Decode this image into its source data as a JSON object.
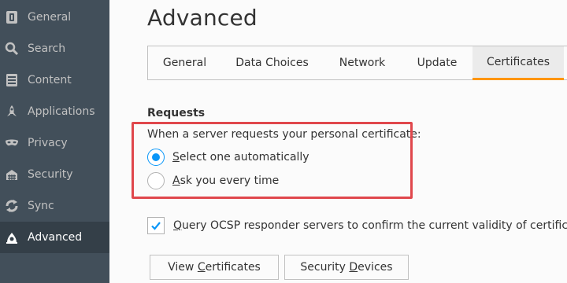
{
  "sidebar": {
    "items": [
      {
        "label": "General",
        "icon": "general-icon"
      },
      {
        "label": "Search",
        "icon": "search-icon"
      },
      {
        "label": "Content",
        "icon": "content-icon"
      },
      {
        "label": "Applications",
        "icon": "applications-icon"
      },
      {
        "label": "Privacy",
        "icon": "privacy-mask-icon"
      },
      {
        "label": "Security",
        "icon": "security-icon"
      },
      {
        "label": "Sync",
        "icon": "sync-icon"
      },
      {
        "label": "Advanced",
        "icon": "advanced-icon",
        "active": true
      }
    ]
  },
  "page": {
    "title": "Advanced"
  },
  "tabs": [
    {
      "label": "General"
    },
    {
      "label": "Data Choices"
    },
    {
      "label": "Network"
    },
    {
      "label": "Update"
    },
    {
      "label": "Certificates",
      "active": true
    }
  ],
  "requests": {
    "heading": "Requests",
    "prompt": "When a server requests your personal certificate:",
    "option_auto_accel": "S",
    "option_auto_rest": "elect one automatically",
    "option_ask_accel": "A",
    "option_ask_rest": "sk you every time",
    "selected": "Select one automatically"
  },
  "ocsp": {
    "accel": "Q",
    "rest": "uery OCSP responder servers to confirm the current validity of certificates",
    "checked": true
  },
  "buttons": {
    "view_pre": "View ",
    "view_accel": "C",
    "view_post": "ertificates",
    "devices_pre": "Security ",
    "devices_accel": "D",
    "devices_post": "evices"
  },
  "colors": {
    "sidebar_bg": "#424f5a",
    "sidebar_active_bg": "#343f48",
    "accent_blue": "#0996f8",
    "tab_underline": "#ff9500",
    "highlight_red": "#e0474c"
  }
}
